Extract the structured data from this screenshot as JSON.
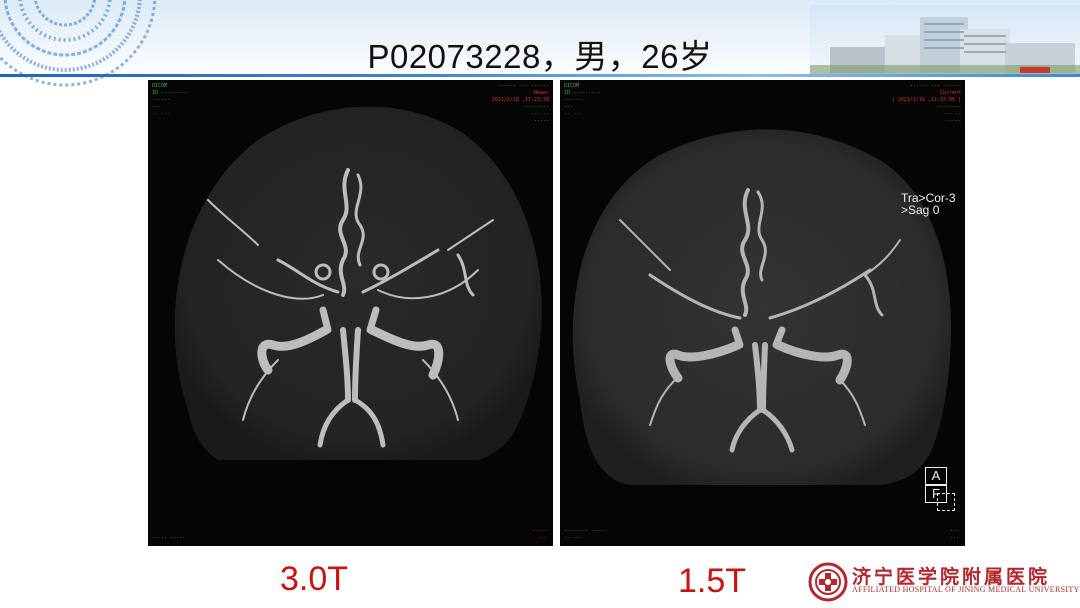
{
  "header": {
    "title": "P02073228，男，26岁"
  },
  "panels": [
    {
      "id": "left",
      "field_label": "3.0T",
      "overlay": {
        "date_time": "2021/2/18 ,17:23:38",
        "viewer_tag": "Newer"
      }
    },
    {
      "id": "right",
      "field_label": "1.5T",
      "overlay": {
        "date_time": "[ 2021/2/16 ,11:37:00 ]",
        "viewer_tag": "Current",
        "projection_line1": "Tra>Cor-3",
        "projection_line2": ">Sag  0",
        "orientation_top": "A",
        "orientation_bottom": "F"
      }
    }
  ],
  "logo": {
    "name_cn": "济宁医学院附属医院",
    "name_en": "AFFILIATED HOSPITAL OF JINING MEDICAL UNIVERSITY"
  },
  "colors": {
    "label_red": "#cc1111",
    "logo_red": "#b5272d",
    "banner_blue": "#1f64b8",
    "overlay_green": "#39b54a"
  }
}
